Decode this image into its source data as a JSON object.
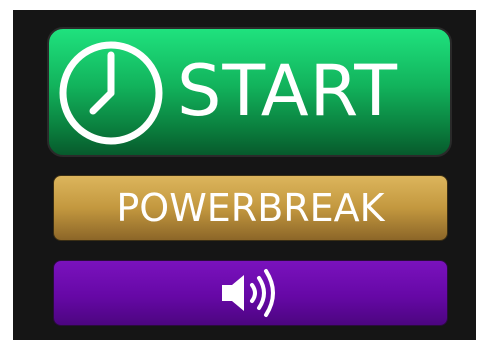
{
  "buttons": {
    "start": {
      "label": "START",
      "icon": "clock-icon"
    },
    "powerbreak": {
      "label": "POWERBREAK"
    },
    "sound": {
      "icon": "speaker-volume-icon"
    }
  },
  "colors": {
    "frame": "#151515",
    "start_top": "#1fe27e",
    "start_bottom": "#075a2c",
    "powerbreak_top": "#dcb55c",
    "powerbreak_bottom": "#8c6628",
    "sound_top": "#7a12bd",
    "sound_bottom": "#4c0580",
    "text": "#ffffff"
  }
}
